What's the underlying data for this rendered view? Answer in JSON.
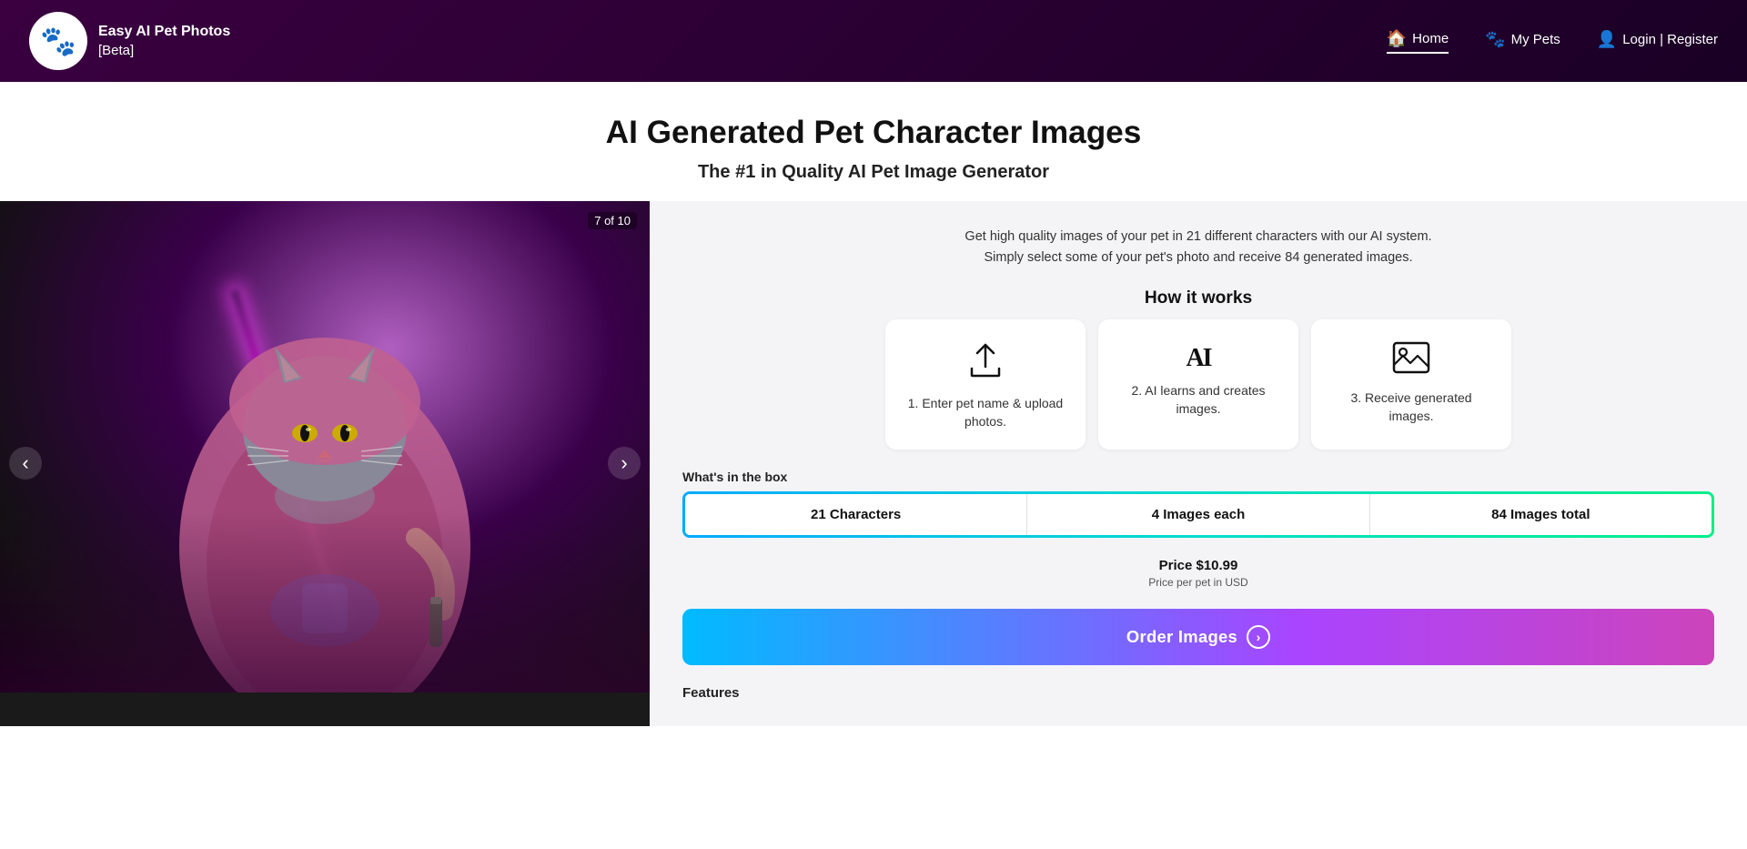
{
  "header": {
    "logo_emoji": "🐾",
    "app_name": "Easy AI Pet Photos",
    "app_beta": "[Beta]",
    "nav": [
      {
        "id": "home",
        "label": "Home",
        "icon": "🏠",
        "active": true
      },
      {
        "id": "my-pets",
        "label": "My Pets",
        "icon": "🐾",
        "active": false
      },
      {
        "id": "login-register",
        "label": "Login | Register",
        "icon": "👤",
        "active": false
      }
    ]
  },
  "hero": {
    "title": "AI Generated Pet Character Images",
    "subtitle": "The #1 in Quality AI Pet Image Generator"
  },
  "carousel": {
    "counter": "7 of 10"
  },
  "info_panel": {
    "description_line1": "Get high quality images of your pet in 21 different characters with our AI system.",
    "description_line2": "Simply select some of your pet's photo and receive 84 generated images.",
    "how_it_works": {
      "title": "How it works",
      "steps": [
        {
          "id": "step-1",
          "icon_type": "upload",
          "label": "1. Enter pet name & upload photos."
        },
        {
          "id": "step-2",
          "icon_type": "ai-text",
          "label": "2. AI learns and creates images."
        },
        {
          "id": "step-3",
          "icon_type": "image-frame",
          "label": "3. Receive generated images."
        }
      ]
    },
    "whats_in_box": {
      "title": "What's in the box",
      "items": [
        {
          "id": "characters",
          "value": "21 Characters"
        },
        {
          "id": "images-each",
          "value": "4 Images each"
        },
        {
          "id": "images-total",
          "value": "84 Images total"
        }
      ]
    },
    "pricing": {
      "price_label": "Price $10.99",
      "price_note": "Price per pet in USD"
    },
    "order_button": {
      "label": "Order Images",
      "icon": "›"
    },
    "features_title": "Features"
  }
}
